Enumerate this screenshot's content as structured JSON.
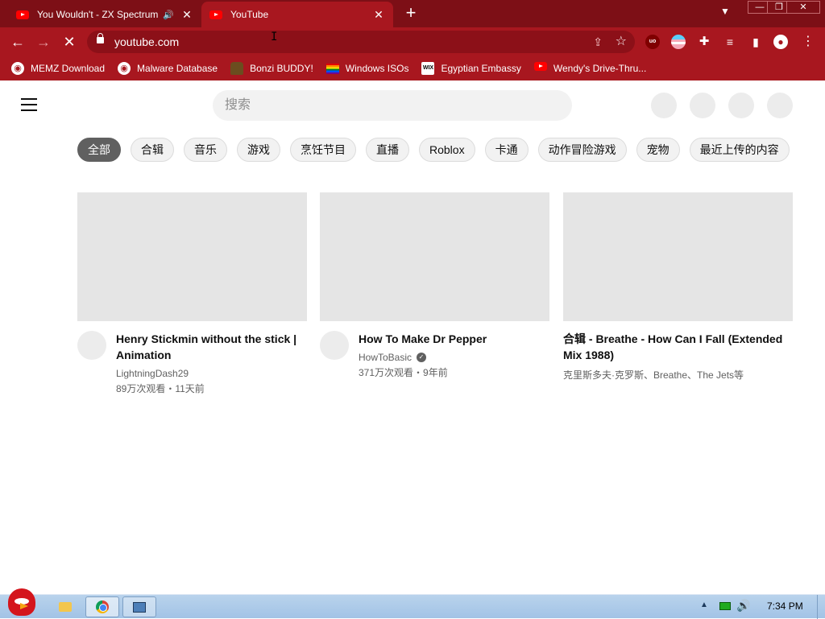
{
  "browser": {
    "tabs": [
      {
        "title": "You Wouldn't - ZX Spectrum",
        "icon": "youtube-icon",
        "audio": true
      },
      {
        "title": "YouTube",
        "icon": "youtube-icon",
        "active": true
      }
    ],
    "url": "youtube.com",
    "bookmarks": [
      {
        "label": "MEMZ Download",
        "icon": "globe-icon"
      },
      {
        "label": "Malware Database",
        "icon": "globe-icon"
      },
      {
        "label": "Bonzi BUDDY!",
        "icon": "bonzi-icon"
      },
      {
        "label": "Windows ISOs",
        "icon": "rainbow-flag-icon"
      },
      {
        "label": "Egyptian Embassy",
        "icon": "wix-icon"
      },
      {
        "label": "Wendy's Drive-Thru...",
        "icon": "youtube-icon"
      }
    ],
    "extensions": {
      "ublock": "uo"
    }
  },
  "youtube": {
    "search_placeholder": "搜索",
    "chips": [
      "全部",
      "合辑",
      "音乐",
      "游戏",
      "烹饪节目",
      "直播",
      "Roblox",
      "卡通",
      "动作冒险游戏",
      "宠物",
      "最近上传的内容"
    ],
    "videos": [
      {
        "title": "Henry Stickmin without the stick | Animation",
        "channel": "LightningDash29",
        "verified": false,
        "stats": "89万次观看・11天前"
      },
      {
        "title": "How To Make Dr Pepper",
        "channel": "HowToBasic",
        "verified": true,
        "stats": "371万次观看・9年前"
      },
      {
        "title": "合辑 - Breathe - How Can I Fall (Extended Mix 1988)",
        "channel": "克里斯多夫·克罗斯、Breathe、The Jets等",
        "verified": false,
        "stats": ""
      }
    ]
  },
  "taskbar": {
    "clock": "7:34 PM"
  },
  "colors": {
    "chrome_dark": "#7d0f16",
    "chrome_main": "#a8171f",
    "chip_active": "#606060"
  }
}
